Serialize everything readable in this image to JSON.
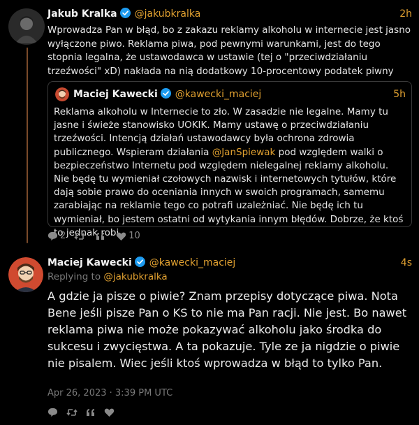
{
  "post1": {
    "author_name": "Jakub Kralka",
    "author_handle": "@jakubkralka",
    "time": "2h",
    "text": "Wprowadza Pan w błąd, bo z zakazu reklamy alkoholu w internecie jest jasno wyłączone piwo. Reklama piwa, pod pewnymi warunkami, jest do tego stopnia legalna, że ustawodawca w ustawie (tej o \"przeciwdziałaniu trzeźwości\" xD) nakłada na nią dodatkowy 10-procentowy podatek piwny",
    "quote": {
      "author_name": "Maciej Kawecki",
      "author_handle": "@kawecki_maciej",
      "time": "5h",
      "text_before_mention": "Reklama alkoholu w Internecie to zło. W zasadzie nie legalne. Mamy tu jasne i świeże stanowisko UOKIK. Mamy ustawę o przeciwdziałaniu trzeźwości. Intencją działań ustawodawcy była ochrona zdrowia publicznego. Wspieram działania ",
      "mention": "@JanSpiewak",
      "text_after_mention": " pod względem walki o bezpieczeństwo Internetu pod względem nielegalnej reklamy alkoholu. Nie będę tu wymieniał czołowych nazwisk i internetowych tytułów, które dają sobie prawo do oceniania innych w swoich programach, samemu zarabiając na reklamie tego co potrafi uzależniać. Nie będę ich tu wymieniał, bo jestem ostatni od wytykania innym błędów. Dobrze, że ktoś to jednak robi."
    },
    "actions": {
      "replies": "2",
      "reposts": "",
      "quotes": "",
      "likes": "10"
    }
  },
  "post2": {
    "author_name": "Maciej Kawecki",
    "author_handle": "@kawecki_maciej",
    "time": "4s",
    "replying_prefix": "Replying to ",
    "replying_handle": "@jakubkralka",
    "text": "A gdzie ja pisze o piwie? Znam przepisy dotyczące piwa. Nota Bene jeśli pisze Pan o KS to nie ma Pan racji. Nie jest. Bo nawet reklama piwa nie może pokazywać alkoholu jako środka do sukcesu i zwycięstwa. A ta pokazuje. Tyle ze ja nigdzie o piwie nie pisalem. Wiec jeśli ktoś wprowadza w błąd to tylko Pan.",
    "date": "Apr 26, 2023 · 3:39 PM UTC"
  },
  "colors": {
    "accent": "#e0a030",
    "verified": "#1d9bf0",
    "background": "#000000",
    "thread_line": "#7a4a2a"
  },
  "icons": [
    "verified-badge-icon",
    "reply-icon",
    "repost-icon",
    "quote-icon",
    "like-icon"
  ]
}
